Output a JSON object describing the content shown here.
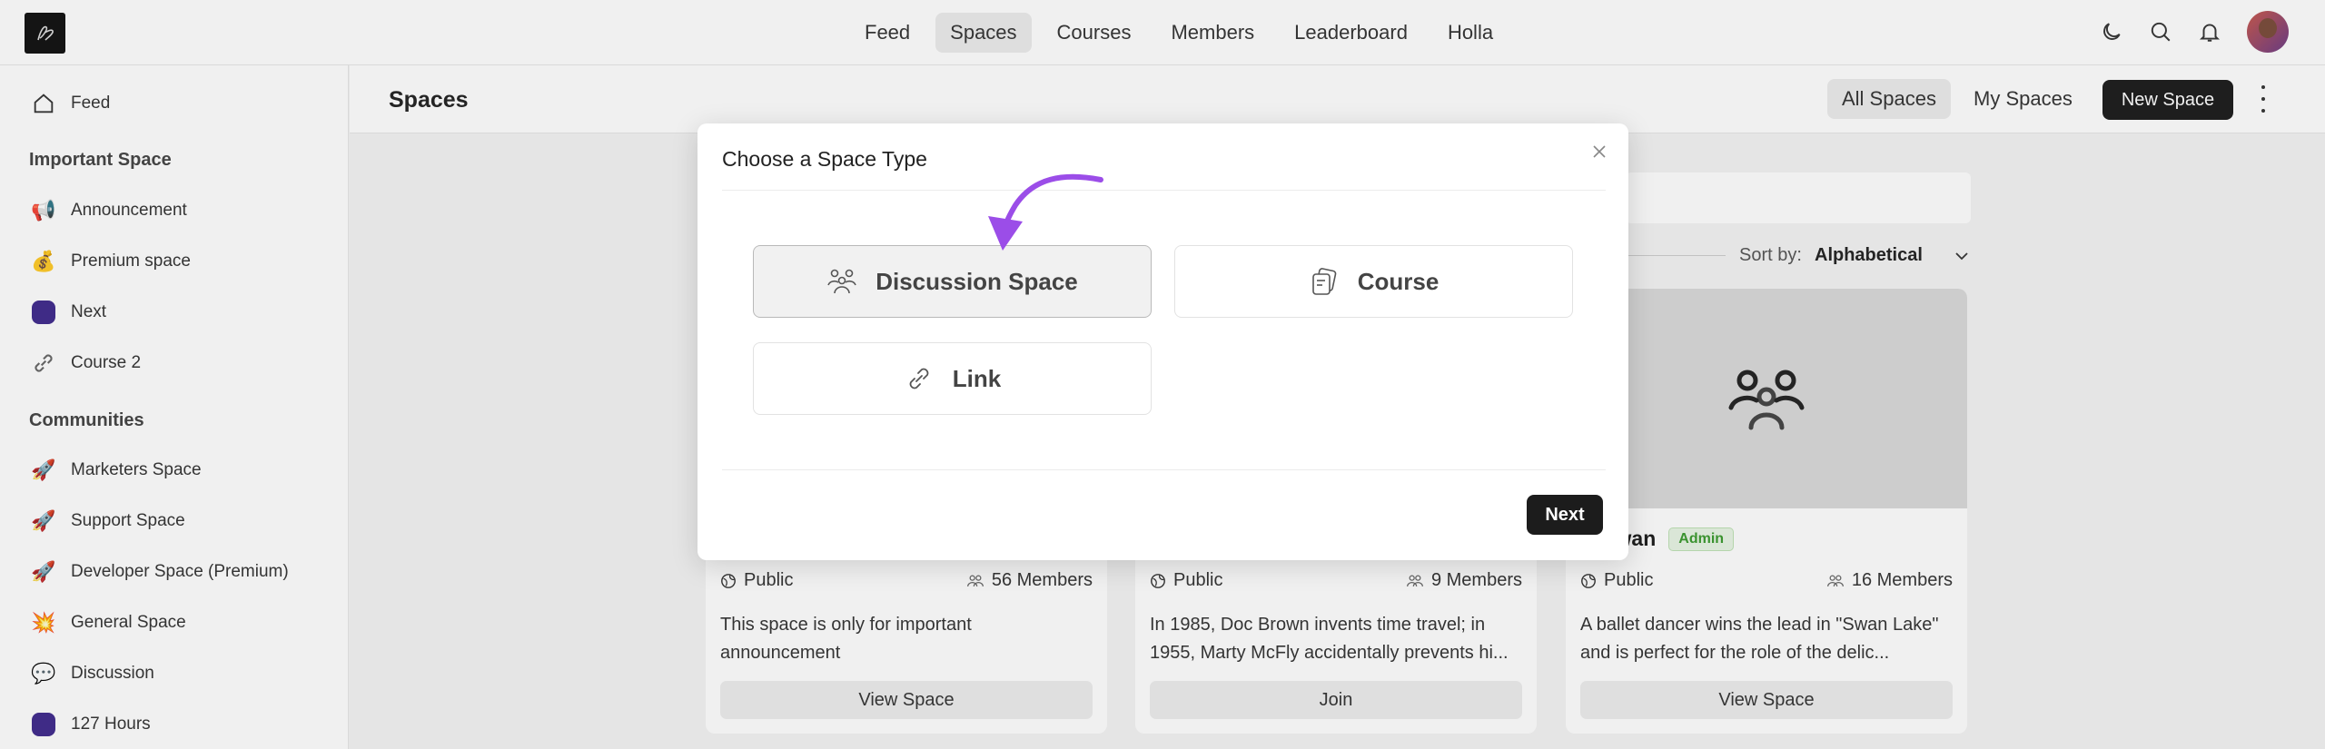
{
  "topbar": {
    "nav": [
      "Feed",
      "Spaces",
      "Courses",
      "Members",
      "Leaderboard",
      "Holla"
    ],
    "active_nav": "Spaces"
  },
  "sidebar": {
    "feed_label": "Feed",
    "important_heading": "Important Space",
    "important_items": [
      "Announcement",
      "Premium space",
      "Next",
      "Course 2"
    ],
    "communities_heading": "Communities",
    "community_items": [
      "Marketers Space",
      "Support Space",
      "Developer Space (Premium)",
      "General Space",
      "Discussion",
      "127 Hours"
    ]
  },
  "header": {
    "title": "Spaces",
    "tab_all": "All Spaces",
    "tab_my": "My Spaces",
    "new_button": "New Space"
  },
  "sort": {
    "label": "Sort by:",
    "value": "Alphabetical"
  },
  "cards": [
    {
      "visibility": "Public",
      "members": "56 Members",
      "desc": "This space is only for important announcement",
      "button": "View Space"
    },
    {
      "visibility": "Public",
      "members": "9 Members",
      "desc": "In 1985, Doc Brown invents time travel; in 1955, Marty McFly accidentally prevents hi...",
      "button": "Join"
    },
    {
      "name": "k Swan",
      "badge": "Admin",
      "visibility": "Public",
      "members": "16 Members",
      "desc": "A ballet dancer wins the lead in \"Swan Lake\" and is perfect for the role of the delic...",
      "button": "View Space"
    }
  ],
  "modal": {
    "title": "Choose a Space Type",
    "options": [
      "Discussion Space",
      "Course",
      "Link"
    ],
    "selected": "Discussion Space",
    "next": "Next"
  },
  "colors": {
    "accent_arrow": "#9b4de8",
    "primary_button": "#1c1c1c"
  }
}
